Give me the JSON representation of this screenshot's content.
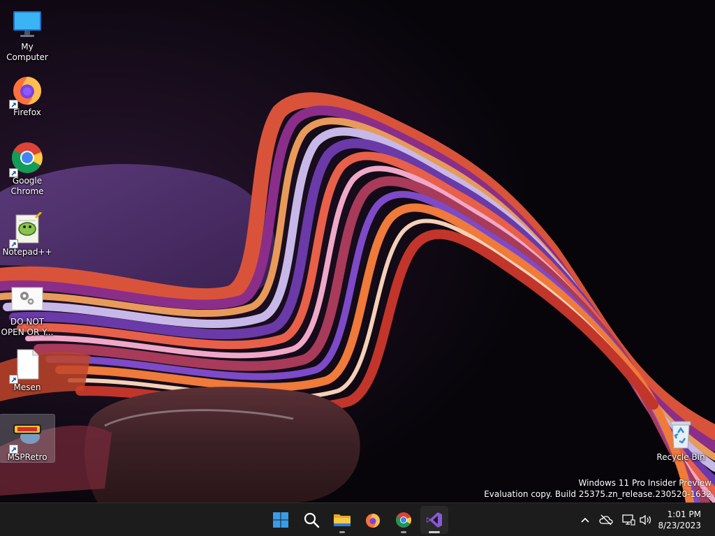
{
  "desktop": {
    "icons": [
      {
        "label": "My Computer",
        "icon": "monitor-icon",
        "shortcut": false
      },
      {
        "label": "Firefox",
        "icon": "firefox-icon",
        "shortcut": true
      },
      {
        "label": "Google Chrome",
        "icon": "chrome-icon",
        "shortcut": true
      },
      {
        "label": "Notepad++",
        "icon": "notepadpp-icon",
        "shortcut": true
      },
      {
        "label": "DO NOT OPEN OR Y...",
        "icon": "settings-file-icon",
        "shortcut": false
      },
      {
        "label": "Mesen",
        "icon": "blank-file-icon",
        "shortcut": true
      },
      {
        "label": "MSPRetro",
        "icon": "mspretro-icon",
        "shortcut": true,
        "selected": true
      }
    ],
    "recycle_bin": {
      "label": "Recycle Bin",
      "icon": "recycle-bin-icon"
    }
  },
  "watermark": {
    "line1": "Windows 11 Pro Insider Preview",
    "line2": "Evaluation copy. Build 25375.zn_release.230520-1632"
  },
  "taskbar": {
    "apps": [
      {
        "name": "start",
        "icon": "windows-logo-icon",
        "running": false
      },
      {
        "name": "search",
        "icon": "search-icon",
        "running": false
      },
      {
        "name": "file-explorer",
        "icon": "folder-icon",
        "running": true
      },
      {
        "name": "firefox",
        "icon": "firefox-icon",
        "running": false
      },
      {
        "name": "chrome",
        "icon": "chrome-icon",
        "running": true
      },
      {
        "name": "visual-studio",
        "icon": "visual-studio-icon",
        "running": true,
        "active": true
      }
    ],
    "tray": {
      "icons": [
        "chevron-up-icon",
        "cloud-off-icon",
        "network-icon",
        "volume-icon"
      ]
    },
    "clock": {
      "time": "1:01 PM",
      "date": "8/23/2023"
    }
  },
  "colors": {
    "taskbar_bg": "#1c1c1c",
    "accent_blue": "#3a9be8",
    "wallpaper_bg": "#0a0609"
  }
}
